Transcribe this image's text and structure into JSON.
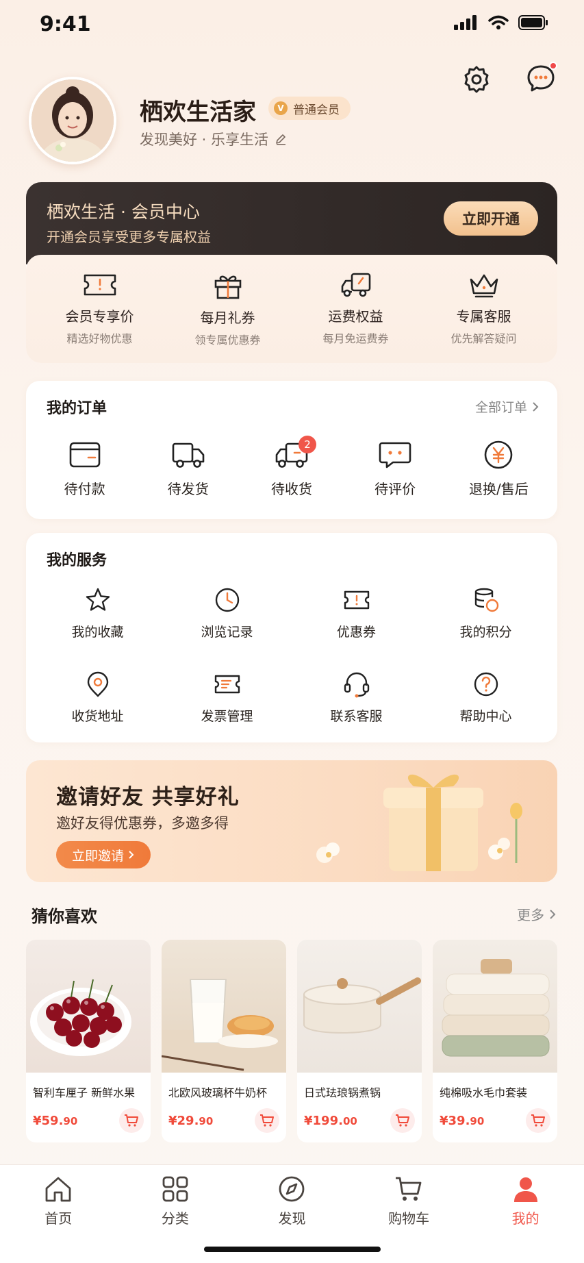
{
  "status": {
    "time": "9:41"
  },
  "profile": {
    "name": "栖欢生活家",
    "level": "普通会员",
    "level_mark": "V",
    "slogan": "发现美好 · 乐享生活"
  },
  "member": {
    "title": "栖欢生活 · 会员中心",
    "subtitle": "开通会员享受更多专属权益",
    "cta": "立即开通",
    "perks": [
      {
        "title": "会员专享价",
        "desc": "精选好物优惠",
        "icon": "coupon-icon"
      },
      {
        "title": "每月礼券",
        "desc": "领专属优惠券",
        "icon": "gift-icon"
      },
      {
        "title": "运费权益",
        "desc": "每月免运费券",
        "icon": "delivery-truck-icon"
      },
      {
        "title": "专属客服",
        "desc": "优先解答疑问",
        "icon": "crown-icon"
      }
    ]
  },
  "orders": {
    "title": "我的订单",
    "more": "全部订单",
    "items": [
      {
        "label": "待付款",
        "icon": "wallet-icon"
      },
      {
        "label": "待发货",
        "icon": "truck-icon"
      },
      {
        "label": "待收货",
        "icon": "delivery-icon",
        "badge": "2"
      },
      {
        "label": "待评价",
        "icon": "comment-icon"
      },
      {
        "label": "退换/售后",
        "icon": "yuan-icon"
      }
    ]
  },
  "services": {
    "title": "我的服务",
    "items": [
      {
        "label": "我的收藏",
        "icon": "star-icon"
      },
      {
        "label": "浏览记录",
        "icon": "clock-icon"
      },
      {
        "label": "优惠券",
        "icon": "ticket-icon"
      },
      {
        "label": "我的积分",
        "icon": "points-icon"
      },
      {
        "label": "收货地址",
        "icon": "location-icon"
      },
      {
        "label": "发票管理",
        "icon": "invoice-icon"
      },
      {
        "label": "联系客服",
        "icon": "headset-icon"
      },
      {
        "label": "帮助中心",
        "icon": "help-icon"
      }
    ]
  },
  "invite": {
    "title": "邀请好友  共享好礼",
    "subtitle": "邀好友得优惠券，多邀多得",
    "cta": "立即邀请"
  },
  "recommend": {
    "title": "猜你喜欢",
    "more": "更多",
    "products": [
      {
        "name": "智利车厘子 新鲜水果",
        "price_main": "¥59.",
        "price_dec": "90"
      },
      {
        "name": "北欧风玻璃杯牛奶杯",
        "price_main": "¥29.",
        "price_dec": "90"
      },
      {
        "name": "日式珐琅锅煮锅",
        "price_main": "¥199.",
        "price_dec": "00"
      },
      {
        "name": "纯棉吸水毛巾套装",
        "price_main": "¥39.",
        "price_dec": "90"
      }
    ]
  },
  "tabbar": {
    "items": [
      {
        "label": "首页",
        "icon": "home-icon"
      },
      {
        "label": "分类",
        "icon": "grid-icon"
      },
      {
        "label": "发现",
        "icon": "compass-icon"
      },
      {
        "label": "购物车",
        "icon": "cart-icon"
      },
      {
        "label": "我的",
        "icon": "person-icon",
        "active": true
      }
    ]
  },
  "colors": {
    "accent": "#f0564a",
    "orange": "#f07a3a",
    "gold": "#f2c18e"
  }
}
